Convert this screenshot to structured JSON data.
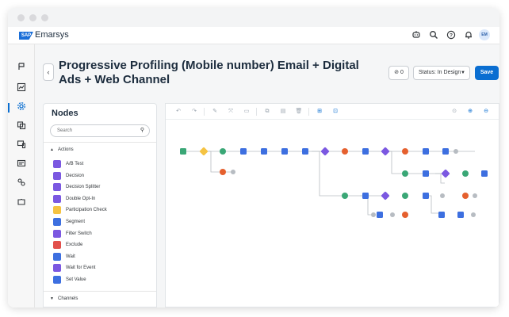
{
  "window": {
    "controls": [
      "close",
      "minimize",
      "maximize"
    ]
  },
  "header": {
    "logo_badge": "SAP",
    "logo_text": "Emarsys",
    "icons": [
      "bot-icon",
      "search-icon",
      "help-icon",
      "bell-icon"
    ],
    "avatar_initials": "EM"
  },
  "sidebar": {
    "items": [
      "campaign-icon",
      "analytics-icon",
      "automation-icon",
      "content-icon",
      "channels-icon",
      "contacts-icon",
      "integrations-icon",
      "addons-icon"
    ],
    "active_index": 2
  },
  "page": {
    "title": "Progressive Profiling (Mobile number) Email + Digital Ads + Web Channel",
    "count": "0",
    "status_label": "Status: In Design",
    "save_label": "Save"
  },
  "nodes_panel": {
    "title": "Nodes",
    "search_placeholder": "Search",
    "actions_label": "Actions",
    "channels_label": "Channels",
    "items": [
      {
        "label": "A/B Test",
        "color": "#7b58e1"
      },
      {
        "label": "Decision",
        "color": "#7b58e1"
      },
      {
        "label": "Decision Splitter",
        "color": "#7b58e1"
      },
      {
        "label": "Double Opt-In",
        "color": "#7b58e1"
      },
      {
        "label": "Participation Check",
        "color": "#f5c342"
      },
      {
        "label": "Segment",
        "color": "#3d6fe0"
      },
      {
        "label": "Filter Switch",
        "color": "#7b58e1"
      },
      {
        "label": "Exclude",
        "color": "#e2504c"
      },
      {
        "label": "Wait",
        "color": "#3d6fe0"
      },
      {
        "label": "Wait for Event",
        "color": "#7b58e1"
      },
      {
        "label": "Set Value",
        "color": "#3d6fe0"
      }
    ]
  },
  "canvas": {
    "toolbar_icons": [
      "undo-icon",
      "redo-icon",
      "edit-icon",
      "connect-icon",
      "comment-icon",
      "copy-icon",
      "paste-icon",
      "delete-icon",
      "auto-layout-icon",
      "grid-icon",
      "fit-icon",
      "zoom-in-icon",
      "zoom-out-icon"
    ]
  }
}
